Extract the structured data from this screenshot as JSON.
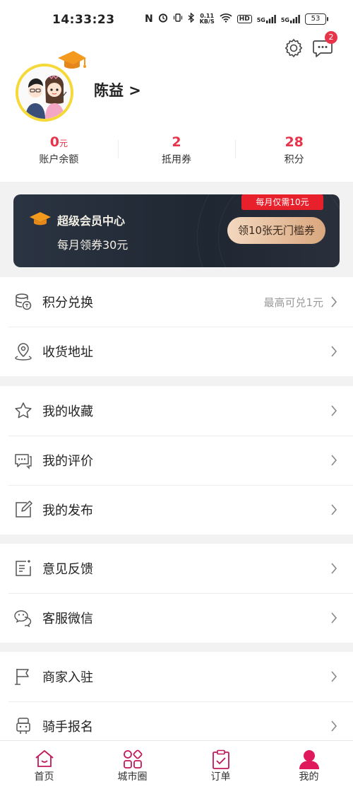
{
  "status_bar": {
    "time": "14:33:23",
    "network_speed_value": "0.11",
    "network_speed_unit": "KB/S",
    "signal1": "5G",
    "signal2": "5G",
    "hd": "HD",
    "battery": "53"
  },
  "header": {
    "message_badge": "2",
    "username": "陈益 >"
  },
  "stats": [
    {
      "value": "0",
      "unit": "元",
      "label": "账户余额"
    },
    {
      "value": "2",
      "unit": "",
      "label": "抵用券"
    },
    {
      "value": "28",
      "unit": "",
      "label": "积分"
    }
  ],
  "vip": {
    "title": "超级会员中心",
    "subtitle": "每月领券30元",
    "tag": "每月仅需10元",
    "button": "领10张无门槛券"
  },
  "menu_groups": [
    {
      "items": [
        {
          "label": "积分兑换",
          "extra": "最高可兑1元",
          "icon": "coins-icon"
        },
        {
          "label": "收货地址",
          "extra": "",
          "icon": "location-icon"
        }
      ]
    },
    {
      "items": [
        {
          "label": "我的收藏",
          "extra": "",
          "icon": "star-icon"
        },
        {
          "label": "我的评价",
          "extra": "",
          "icon": "comment-icon"
        },
        {
          "label": "我的发布",
          "extra": "",
          "icon": "edit-icon"
        }
      ]
    },
    {
      "items": [
        {
          "label": "意见反馈",
          "extra": "",
          "icon": "feedback-icon"
        },
        {
          "label": "客服微信",
          "extra": "",
          "icon": "wechat-icon"
        }
      ]
    },
    {
      "items": [
        {
          "label": "商家入驻",
          "extra": "",
          "icon": "flag-icon"
        },
        {
          "label": "骑手报名",
          "extra": "",
          "icon": "rider-icon"
        }
      ]
    }
  ],
  "tabs": [
    {
      "label": "首页",
      "icon": "home-icon"
    },
    {
      "label": "城市圈",
      "icon": "grid-icon"
    },
    {
      "label": "订单",
      "icon": "clipboard-icon"
    },
    {
      "label": "我的",
      "icon": "user-icon",
      "active": true
    }
  ],
  "colors": {
    "accent": "#e8344a",
    "tab_icon": "#c2185b",
    "avatar_ring": "#f5d938",
    "vip_bg": "#1f2732"
  }
}
